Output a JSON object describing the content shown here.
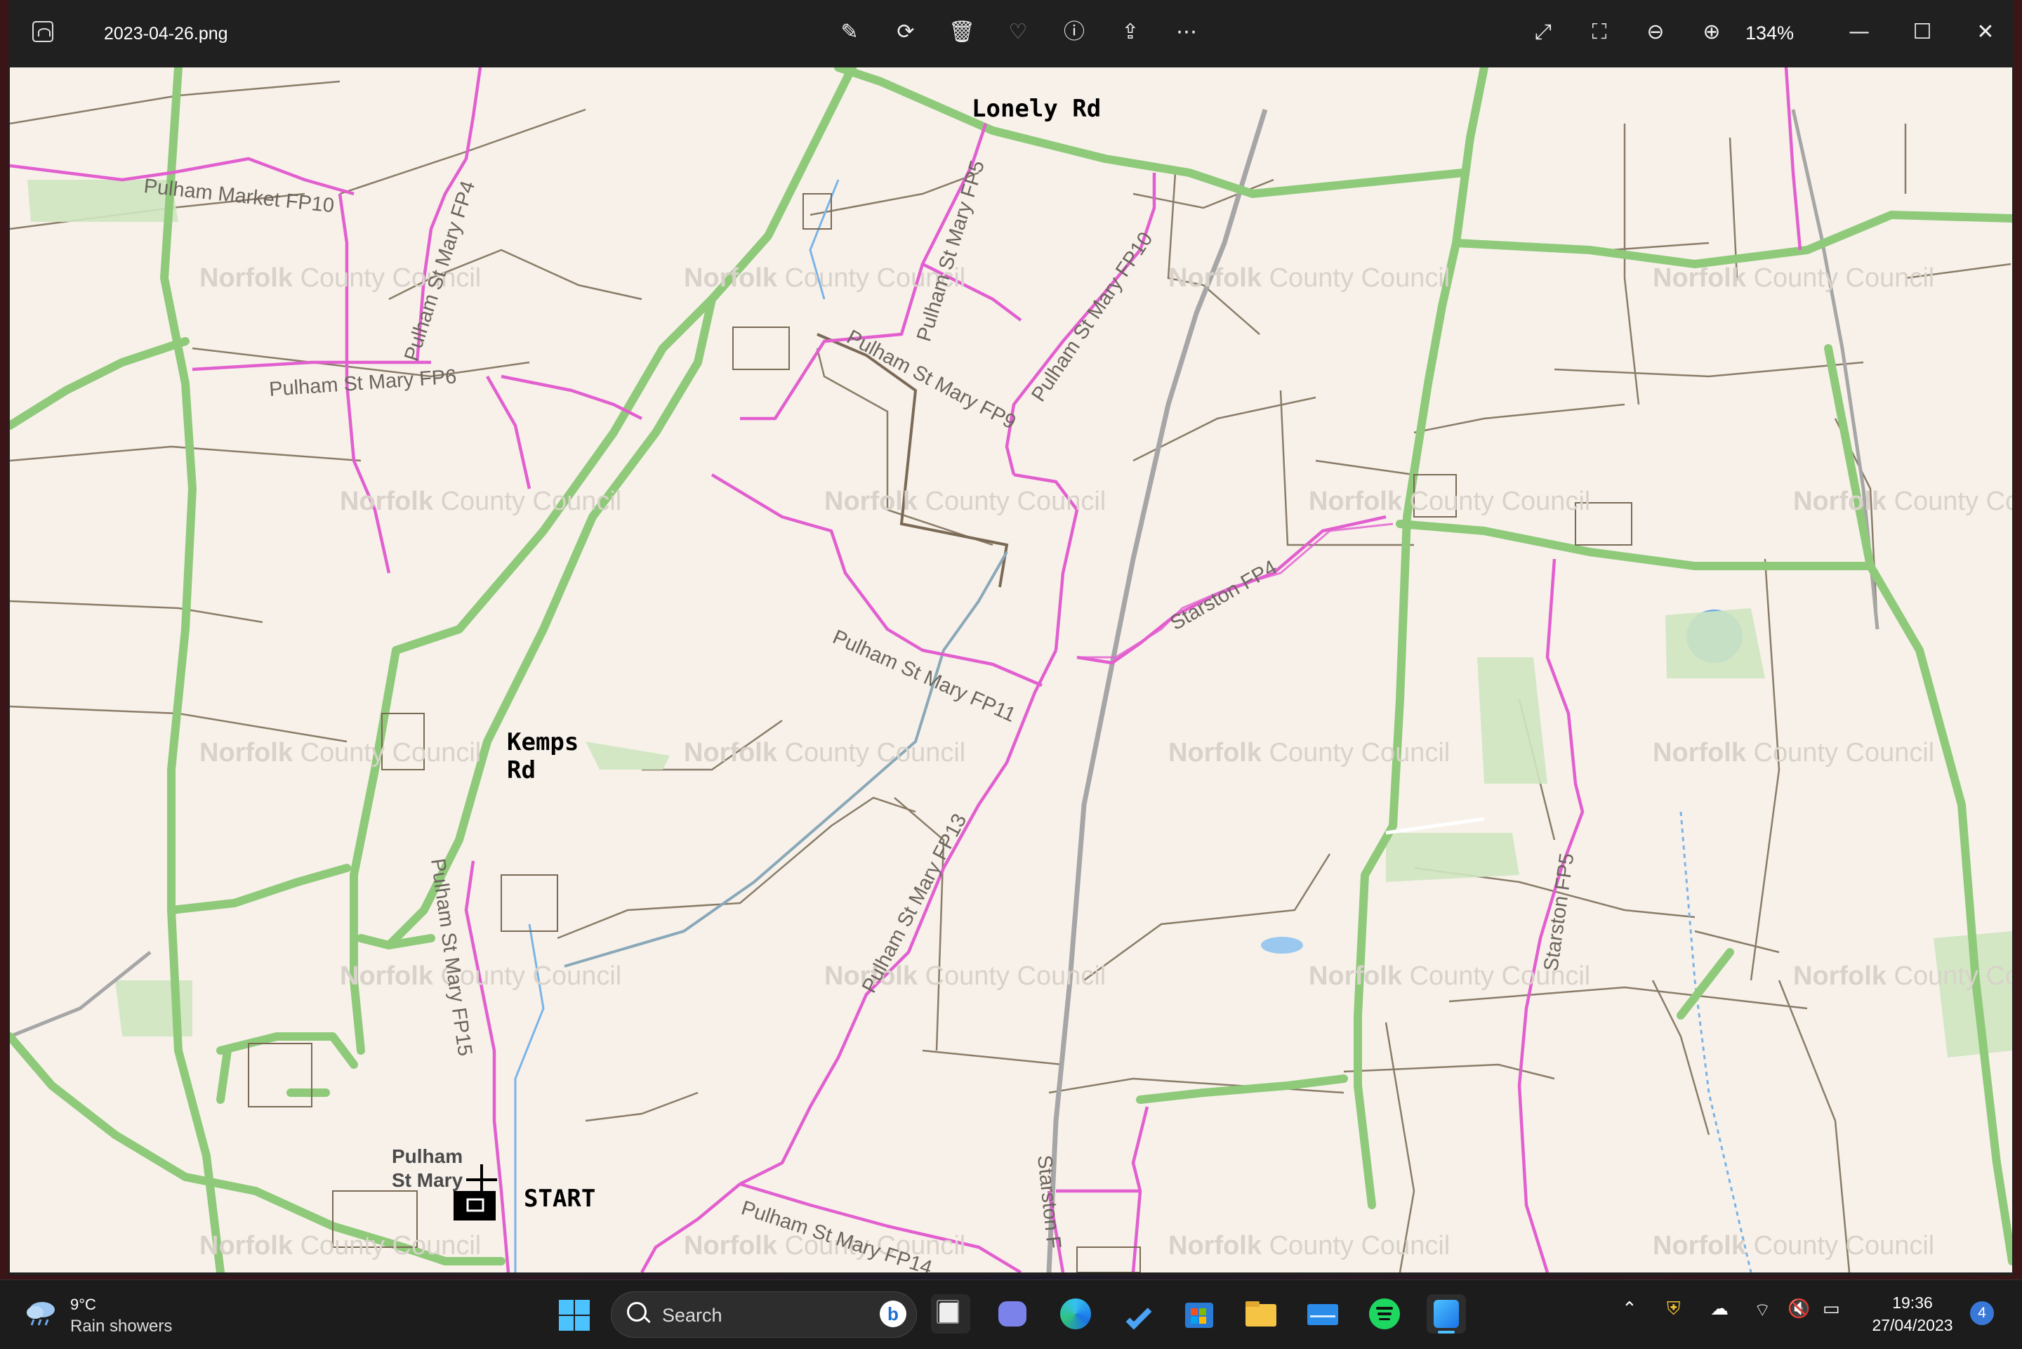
{
  "window": {
    "filename": "2023-04-26.png",
    "zoom": "134%",
    "toolbar_icons": [
      "edit-icon",
      "rotate-icon",
      "delete-icon",
      "favorite-icon",
      "info-icon",
      "share-icon",
      "more-icon"
    ],
    "right_icons": [
      "fullscreen-icon",
      "fit-icon",
      "zoom-out-icon",
      "zoom-in-icon"
    ]
  },
  "map": {
    "annotations": {
      "road_lonely": "Lonely Rd",
      "road_kemps_1": "Kemps",
      "road_kemps_2": "Rd",
      "start": "START",
      "village_1": "Pulham",
      "village_2": "St Mary"
    },
    "paths": {
      "fp10_market": "Pulham Market FP10",
      "fp4": "Pulham St Mary FP4",
      "fp6": "Pulham St Mary FP6",
      "fp5": "Pulham St Mary FP5",
      "fp9": "Pulham St Mary FP9",
      "fp10": "Pulham St Mary FP10",
      "fp11": "Pulham St Mary FP11",
      "fp13": "Pulham St Mary FP13",
      "fp14": "Pulham St Mary FP14",
      "fp15": "Pulham St Mary FP15",
      "starston_fp4": "Starston FP4",
      "starston_fp5": "Starston FP5",
      "starston_fp": "Starston F"
    },
    "watermark_bold": "Norfolk",
    "watermark_light": "County Council",
    "colors": {
      "footpath": "#e25fcf",
      "road": "#8fca7a",
      "field": "#7a6a55",
      "water": "#7ab4e6"
    }
  },
  "taskbar": {
    "weather_temp": "9°C",
    "weather_cond": "Rain showers",
    "search_placeholder": "Search",
    "time": "19:36",
    "date": "27/04/2023",
    "notifications": "4"
  }
}
